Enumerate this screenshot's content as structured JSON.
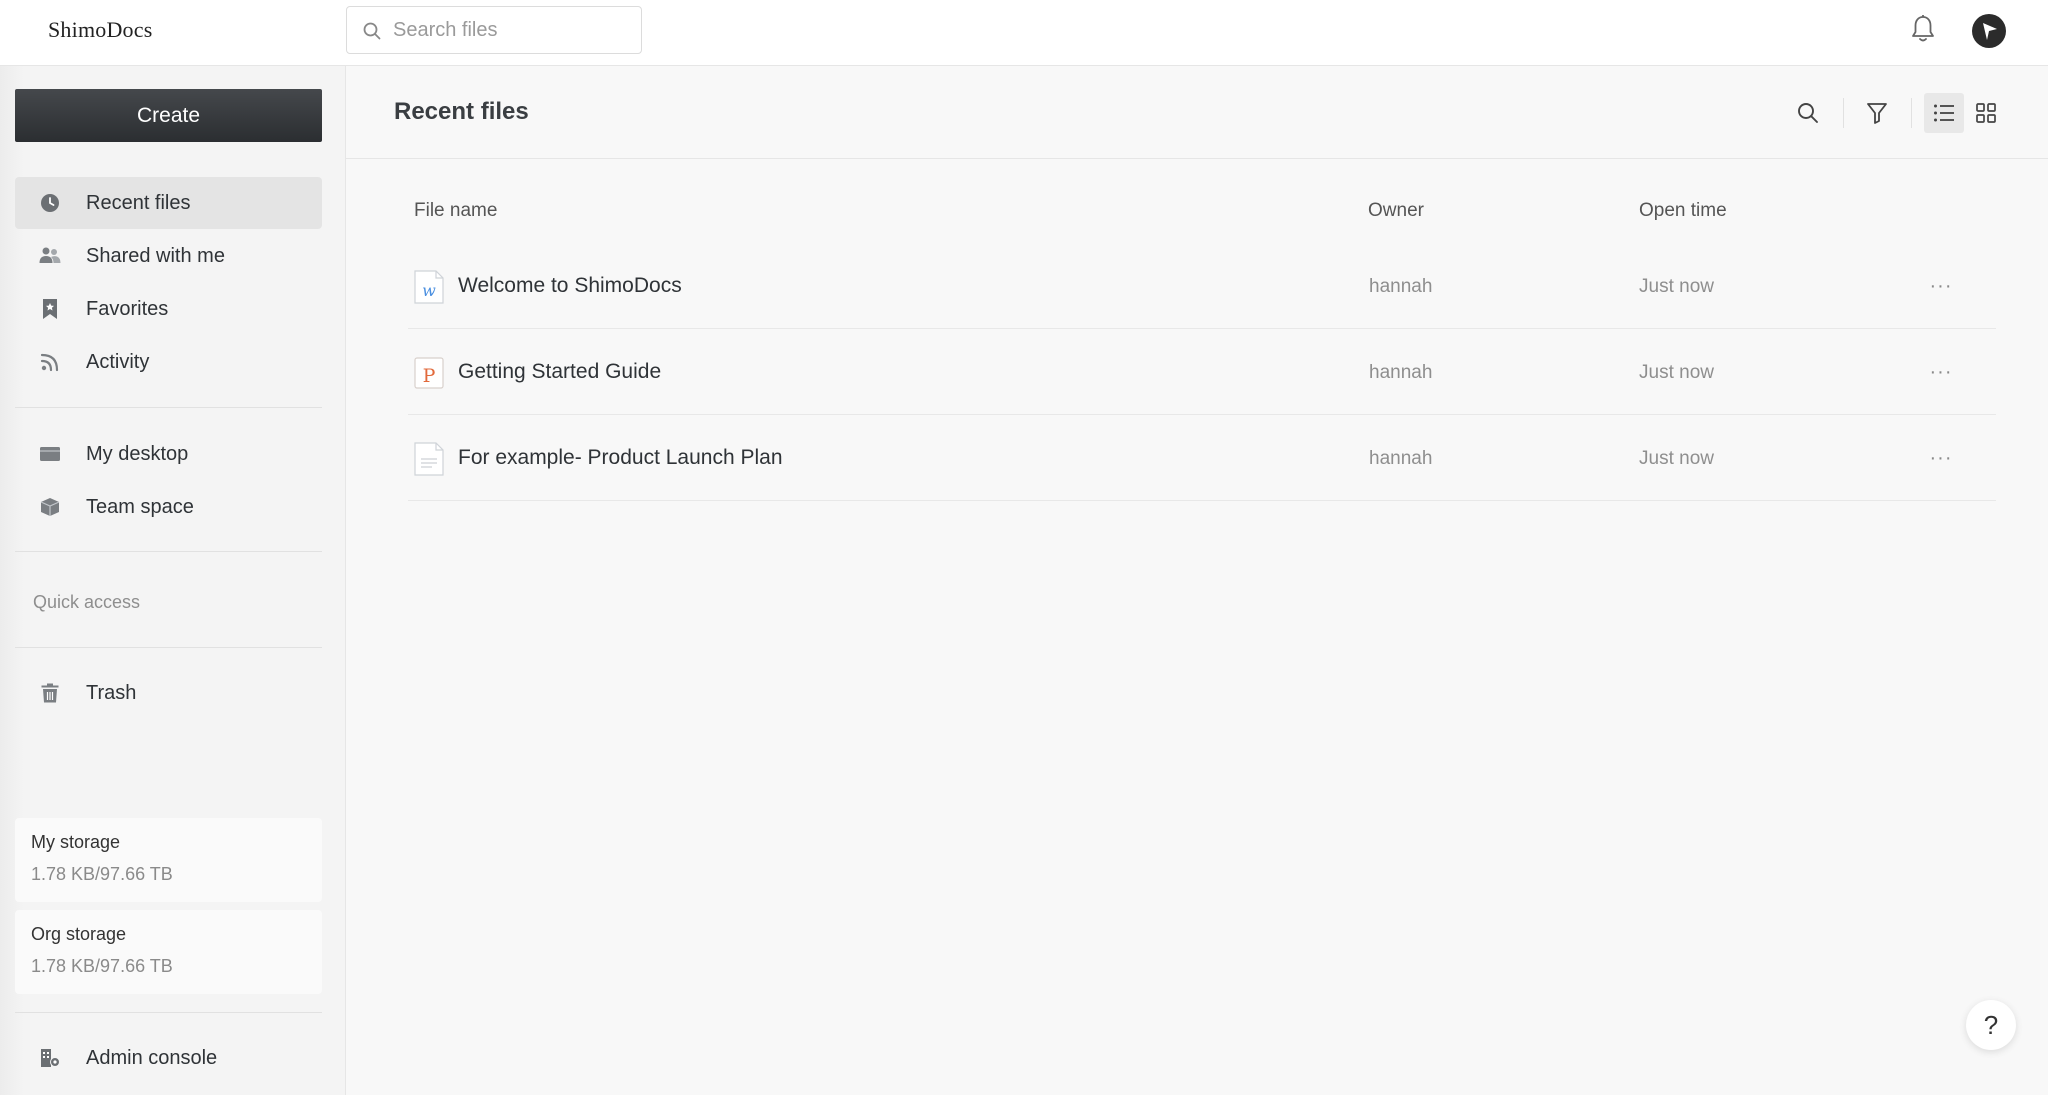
{
  "app": {
    "logo": "ShimoDocs"
  },
  "search": {
    "placeholder": "Search files"
  },
  "sidebar": {
    "create_label": "Create",
    "nav": [
      {
        "label": "Recent files",
        "icon": "clock-icon",
        "active": true
      },
      {
        "label": "Shared with me",
        "icon": "people-icon"
      },
      {
        "label": "Favorites",
        "icon": "bookmark-icon"
      },
      {
        "label": "Activity",
        "icon": "rss-icon"
      },
      {
        "label": "My desktop",
        "icon": "desktop-icon"
      },
      {
        "label": "Team space",
        "icon": "cube-icon"
      }
    ],
    "quick_access_label": "Quick access",
    "trash_label": "Trash",
    "storage": [
      {
        "title": "My storage",
        "value": "1.78 KB/97.66 TB"
      },
      {
        "title": "Org storage",
        "value": "1.78 KB/97.66 TB"
      }
    ],
    "admin_label": "Admin console"
  },
  "main": {
    "title": "Recent files",
    "columns": {
      "name": "File name",
      "owner": "Owner",
      "time": "Open time"
    },
    "files": [
      {
        "name": "Welcome to ShimoDocs",
        "owner": "hannah",
        "time": "Just now",
        "type": "word-doc-icon"
      },
      {
        "name": "Getting Started Guide",
        "owner": "hannah",
        "time": "Just now",
        "type": "presentation-icon"
      },
      {
        "name": "For example- Product Launch Plan",
        "owner": "hannah",
        "time": "Just now",
        "type": "document-icon"
      }
    ],
    "more_label": "···"
  },
  "help_label": "?",
  "colors": {
    "create_button": "#2f3235",
    "active_nav": "#e4e4e4",
    "word_blue": "#4a8fe0",
    "ppt_orange": "#e26a3c"
  }
}
